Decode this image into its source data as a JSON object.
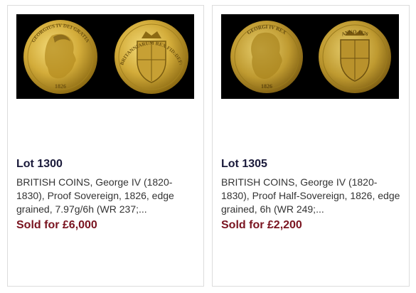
{
  "lots": [
    {
      "lot_label": "Lot 1300",
      "description": "BRITISH COINS, George IV (1820-1830), Proof Sovereign, 1826, edge grained, 7.97g/6h (WR 237;...",
      "sold_prefix": "Sold for ",
      "sold_amount": "£6,000",
      "obverse_legend": "GEORGIUS IV DEI GRATIA",
      "obverse_date": "1826",
      "reverse_legend": "BRITANNIARUM REX FID:DEF:"
    },
    {
      "lot_label": "Lot 1305",
      "description": "BRITISH COINS, George IV (1820-1830), Proof Half-Sovereign, 1826, edge grained, 6h (WR 249;...",
      "sold_prefix": "Sold for ",
      "sold_amount": "£2,200",
      "obverse_legend": "GEORGI IV REX",
      "obverse_date": "1826",
      "reverse_legend": "ANNO 1826"
    }
  ],
  "colors": {
    "lot_title": "#1a1a3a",
    "sold_price": "#7a1420",
    "coin_gold": "#d9b443",
    "coin_background": "#000000"
  },
  "icons": [
    "coin-obverse-image",
    "coin-reverse-image"
  ]
}
